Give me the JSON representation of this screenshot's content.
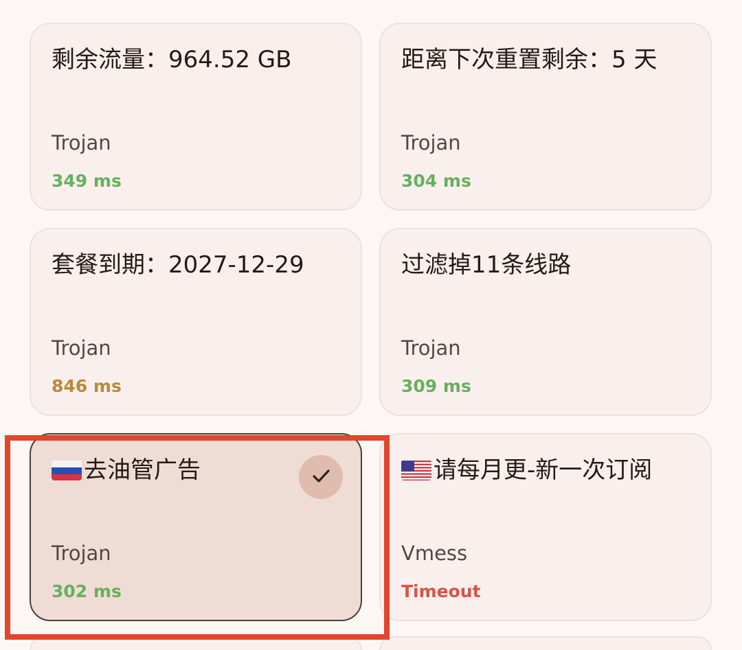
{
  "nodes": [
    {
      "title": "剩余流量：964.52 GB",
      "protocol": "Trojan",
      "latency": "349 ms",
      "latency_status": "good"
    },
    {
      "title": "距离下次重置剩余：5 天",
      "protocol": "Trojan",
      "latency": "304 ms",
      "latency_status": "good"
    },
    {
      "title": "套餐到期：2027-12-29",
      "protocol": "Trojan",
      "latency": "846 ms",
      "latency_status": "warn"
    },
    {
      "title": "过滤掉11条线路",
      "protocol": "Trojan",
      "latency": "309 ms",
      "latency_status": "good"
    },
    {
      "flag": "russia-flag-icon",
      "title": "去油管广告",
      "protocol": "Trojan",
      "latency": "302 ms",
      "latency_status": "good",
      "selected": true
    },
    {
      "flag": "usa-flag-icon",
      "title": "请每月更-新一次订阅",
      "protocol": "Vmess",
      "latency": "Timeout",
      "latency_status": "bad"
    }
  ],
  "colors": {
    "latency_good": "#66b05c",
    "latency_warn": "#b98a3c",
    "latency_bad": "#d9534a",
    "selected_card": "#efddd5",
    "highlight": "#e2462d"
  },
  "icons": {
    "selected_check": "check-icon"
  }
}
